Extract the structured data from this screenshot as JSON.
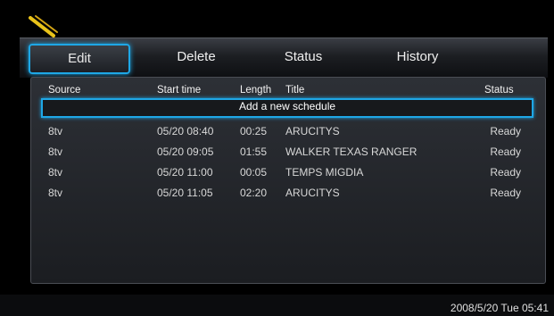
{
  "tabs": [
    {
      "label": "Edit",
      "active": true
    },
    {
      "label": "Delete"
    },
    {
      "label": "Status"
    },
    {
      "label": "History"
    }
  ],
  "table": {
    "headers": {
      "source": "Source",
      "start": "Start time",
      "length": "Length",
      "title": "Title",
      "status": "Status"
    },
    "add_label": "Add a new schedule",
    "rows": [
      {
        "source": "8tv",
        "start": "05/20 08:40",
        "length": "00:25",
        "title": "ARUCITYS",
        "status": "Ready"
      },
      {
        "source": "8tv",
        "start": "05/20 09:05",
        "length": "01:55",
        "title": "WALKER TEXAS RANGER",
        "status": "Ready"
      },
      {
        "source": "8tv",
        "start": "05/20 11:00",
        "length": "00:05",
        "title": "TEMPS MIGDIA",
        "status": "Ready"
      },
      {
        "source": "8tv",
        "start": "05/20 11:05",
        "length": "02:20",
        "title": "ARUCITYS",
        "status": "Ready"
      }
    ]
  },
  "datetime": "2008/5/20 Tue 05:41",
  "colors": {
    "accent": "#1ea7e6",
    "logo": "#e8c21a"
  },
  "icons": {
    "logo": "pencil-logo-icon"
  }
}
